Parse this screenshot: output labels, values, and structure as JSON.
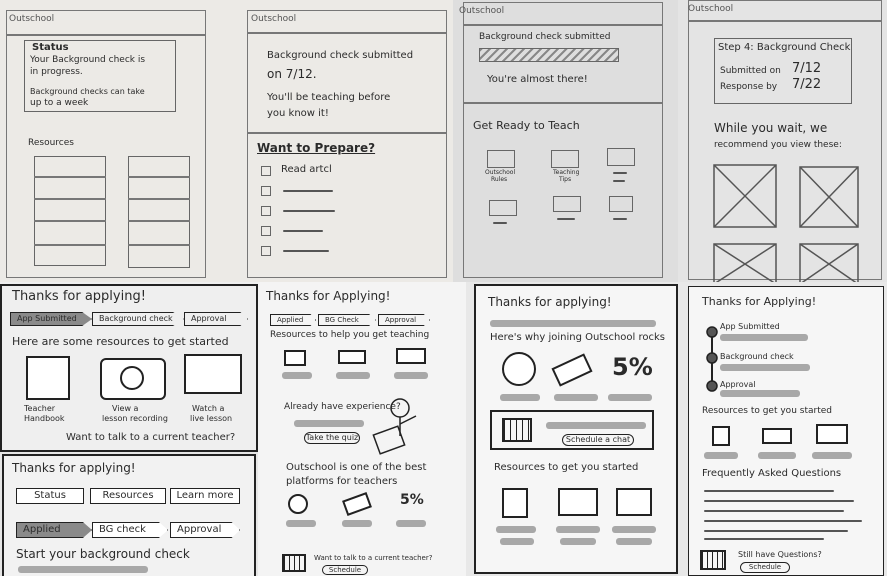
{
  "p1": {
    "brand": "Outschool",
    "status_title": "Status",
    "status_line1": "Your Background check is",
    "status_line2": "in progress.",
    "status_line3": "Background checks can take",
    "status_line4": "up to a week",
    "resources": "Resources"
  },
  "p2": {
    "brand": "Outschool",
    "line1": "Background check submitted",
    "line2": "on 7/12.",
    "line3": "You'll be teaching before",
    "line4": "you know it!",
    "prepare": "Want to Prepare?",
    "read": "Read artcl"
  },
  "p3": {
    "brand": "Outschool",
    "progress_label": "Background check submitted",
    "almost": "You're almost there!",
    "get_ready": "Get Ready to Teach",
    "icon1": "Outschool",
    "icon1b": "Rules",
    "icon2": "Teaching",
    "icon2b": "Tips"
  },
  "p4": {
    "brand": "Outschool",
    "step": "Step 4: Background Check",
    "submitted": "Submitted on",
    "submitted_date": "7/12",
    "response": "Response by",
    "response_date": "7/22",
    "wait1": "While you wait, we",
    "wait2": "recommend you view these:"
  },
  "p5": {
    "title": "Thanks for applying!",
    "steps": [
      "App Submitted",
      "Background check",
      "Approval"
    ],
    "heading": "Here are some resources to get started",
    "r1a": "Teacher",
    "r1b": "Handbook",
    "r2a": "View a",
    "r2b": "lesson recording",
    "r3a": "Watch a",
    "r3b": "live lesson",
    "talk": "Want to talk to a current teacher?"
  },
  "p6": {
    "title": "Thanks for Applying!",
    "steps": [
      "Applied",
      "BG Check",
      "Approval"
    ],
    "resources": "Resources to help you get teaching",
    "experience": "Already have experience?",
    "quiz": "Take the quiz",
    "best1": "Outschool is one of the best",
    "best2": "platforms for teachers",
    "pct": "5%",
    "talk": "Want to talk to a current teacher?",
    "schedule": "Schedule"
  },
  "p7": {
    "title": "Thanks for applying!",
    "why": "Here's why joining Outschool rocks",
    "pct": "5%",
    "chat": "Schedule a chat",
    "resources": "Resources to get you started"
  },
  "p8": {
    "title": "Thanks for Applying!",
    "steps": [
      "App Submitted",
      "Background check",
      "Approval"
    ],
    "resources": "Resources to get you started",
    "faq": "Frequently Asked Questions",
    "still": "Still have Questions?",
    "schedule": "Schedule"
  },
  "p9": {
    "title": "Thanks for applying!",
    "tabs": [
      "Status",
      "Resources",
      "Learn more"
    ],
    "steps": [
      "Applied",
      "BG check",
      "Approval"
    ],
    "start": "Start your background check"
  }
}
